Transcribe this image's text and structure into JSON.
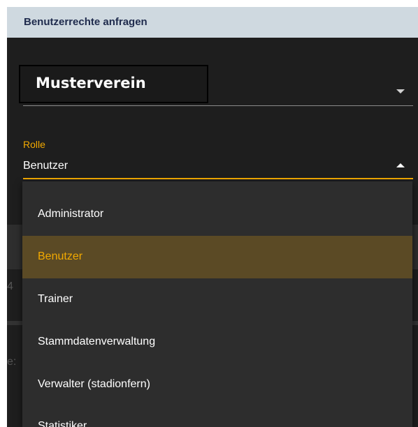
{
  "dialog": {
    "title": "Benutzerrechte anfragen"
  },
  "verein": {
    "selected": "Musterverein"
  },
  "rolle": {
    "label": "Rolle",
    "value": "Benutzer",
    "options": [
      "Administrator",
      "Benutzer",
      "Trainer",
      "Stammdatenverwaltung",
      "Verwalter (stadionfern)",
      "Statistiker"
    ]
  },
  "background": {
    "ghost_digit": "4",
    "ghost_text": "e:"
  },
  "colors": {
    "accent": "#f2a900",
    "header_bg": "#cfd9e0",
    "dialog_bg": "#1e1e1e",
    "menu_bg": "#2d2d2d",
    "selected_bg": "#5b4a25"
  }
}
